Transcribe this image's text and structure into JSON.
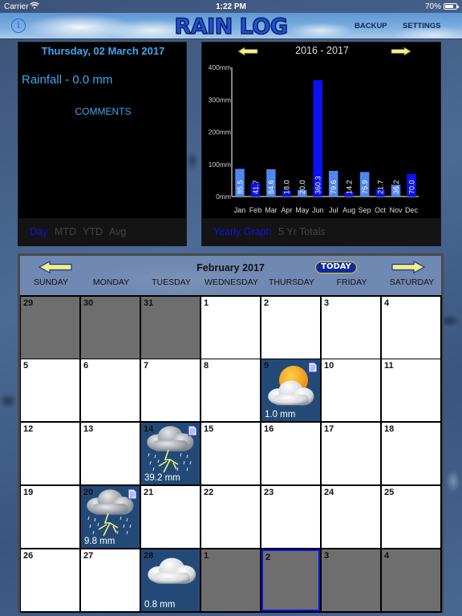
{
  "status_bar": {
    "carrier": "Carrier",
    "wifi_icon": "wifi-icon",
    "time": "1:22 PM",
    "battery": "70%",
    "battery_level": 0.7
  },
  "navbar": {
    "title": "RAIN LOG",
    "info_label": "i",
    "backup_label": "BACKUP",
    "settings_label": "SETTINGS"
  },
  "day_panel": {
    "date": "Thursday, 02 March 2017",
    "rainfall": "Rainfall - 0.0 mm",
    "comments_label": "COMMENTS",
    "tabs": [
      {
        "label": "Day",
        "active": true
      },
      {
        "label": "MTD",
        "active": false
      },
      {
        "label": "YTD",
        "active": false
      },
      {
        "label": "Avg",
        "active": false
      }
    ]
  },
  "graph_panel": {
    "season": "2016 - 2017",
    "tabs": [
      {
        "label": "Yearly Graph",
        "active": true
      },
      {
        "label": "5 Yr Totals",
        "active": false
      }
    ]
  },
  "chart_data": {
    "type": "bar",
    "title": "2016 - 2017",
    "xlabel": "",
    "ylabel": "",
    "unit": "mm",
    "ylim": [
      0,
      400
    ],
    "yticks": [
      0,
      100,
      200,
      300,
      400
    ],
    "ytick_labels": [
      "0mm",
      "100mm",
      "200mm",
      "300mm",
      "400mm"
    ],
    "categories": [
      "Jan",
      "Feb",
      "Mar",
      "Apr",
      "May",
      "Jun",
      "Jul",
      "Aug",
      "Sep",
      "Oct",
      "Nov",
      "Dec"
    ],
    "values": [
      85.5,
      41.7,
      84.6,
      18.0,
      20.0,
      360.3,
      79.6,
      14.2,
      75.9,
      21.7,
      36.2,
      70.0
    ],
    "value_labels": [
      "85.5",
      "41.7",
      "84.6",
      "18.0",
      "20.0",
      "360.3",
      "79.6",
      "14.2",
      "75.9",
      "21.7",
      "36.2",
      "70.0"
    ],
    "bar_colors": [
      "#4f86f0",
      "#0a12f0",
      "#4f86f0",
      "#0a12f0",
      "#4f86f0",
      "#0a12f0",
      "#4f86f0",
      "#0a12f0",
      "#4f86f0",
      "#0a12f0",
      "#4f86f0",
      "#0a12f0"
    ],
    "grid": false,
    "legend": "none"
  },
  "calendar": {
    "title": "February 2017",
    "today_label": "TODAY",
    "weekdays": [
      "SUNDAY",
      "MONDAY",
      "TUESDAY",
      "WEDNESDAY",
      "THURSDAY",
      "FRIDAY",
      "SATURDAY"
    ],
    "weeks": [
      [
        {
          "day": "29",
          "other": true
        },
        {
          "day": "30",
          "other": true
        },
        {
          "day": "31",
          "other": true
        },
        {
          "day": "1"
        },
        {
          "day": "2"
        },
        {
          "day": "3"
        },
        {
          "day": "4"
        }
      ],
      [
        {
          "day": "5"
        },
        {
          "day": "6"
        },
        {
          "day": "7"
        },
        {
          "day": "8"
        },
        {
          "day": "9",
          "weather": "sun-cloud",
          "amount": "1.0 mm",
          "note": true
        },
        {
          "day": "10"
        },
        {
          "day": "11"
        }
      ],
      [
        {
          "day": "12"
        },
        {
          "day": "13"
        },
        {
          "day": "14",
          "weather": "thunderstorm",
          "amount": "39.2 mm",
          "note": true
        },
        {
          "day": "15"
        },
        {
          "day": "16"
        },
        {
          "day": "17"
        },
        {
          "day": "18"
        }
      ],
      [
        {
          "day": "19"
        },
        {
          "day": "20",
          "weather": "thunderstorm",
          "amount": "9.8 mm",
          "note": true
        },
        {
          "day": "21"
        },
        {
          "day": "22"
        },
        {
          "day": "23"
        },
        {
          "day": "24"
        },
        {
          "day": "25"
        }
      ],
      [
        {
          "day": "26"
        },
        {
          "day": "27"
        },
        {
          "day": "28",
          "weather": "cloud",
          "amount": "0.8 mm",
          "note": false
        },
        {
          "day": "1",
          "other": true
        },
        {
          "day": "2",
          "other": true,
          "selected": true
        },
        {
          "day": "3",
          "other": true
        },
        {
          "day": "4",
          "other": true
        }
      ]
    ]
  }
}
